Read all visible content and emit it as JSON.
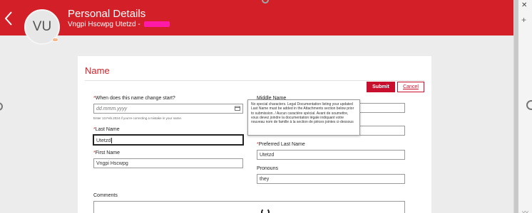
{
  "header": {
    "avatar_initials": "VU",
    "title": "Personal Details",
    "subtitle": "Vngpi Hscwpg Utetzd -"
  },
  "section": {
    "title": "Name"
  },
  "actions": {
    "submit_label": "Submit",
    "cancel_label": "Cancel"
  },
  "fields": {
    "change_start": {
      "label": "When does this name change start?",
      "placeholder": "dd.mmm.yyyy",
      "hint": "Enter 13.Feb.2024 if you're correcting a mistake in your name."
    },
    "last_name": {
      "label": "Last Name",
      "value": "Utetzd"
    },
    "first_name": {
      "label": "First Name",
      "value": "Vngpi Hscwpg"
    },
    "middle_name": {
      "label": "Middle Name",
      "value": ""
    },
    "second_right_field": {
      "value": ""
    },
    "preferred_last_name": {
      "label": "Preferred Last Name",
      "value": "Utetzd"
    },
    "pronouns": {
      "label": "Pronouns",
      "value": "they"
    },
    "comments": {
      "label": "Comments",
      "value": ""
    }
  },
  "tooltip": {
    "text": "No special characters. Legal Documentation listing your updated Last Name must be added in the Attachments section below prior to submission. / Aucun caractère spécial. Avant de soumettre, vous devez joindre la documentation légale indiquant votre nouveau nom de famille à la section de pièces jointes ci-dessous"
  },
  "colors": {
    "brand_red": "#d31f27",
    "redaction": "#ff1aa8"
  },
  "icons": [
    "back-chevron-icon",
    "calendar-icon",
    "close-icon",
    "plus-icon",
    "loading-spinner-icon"
  ]
}
